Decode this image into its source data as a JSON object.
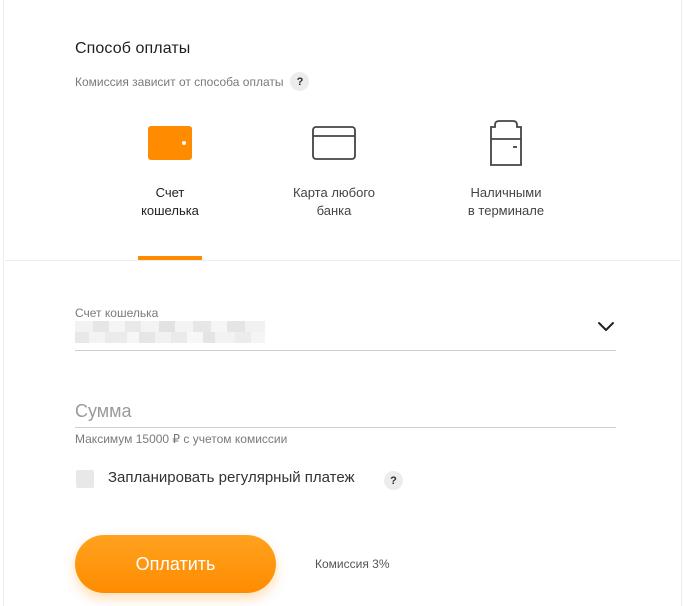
{
  "payment_method": {
    "title": "Способ оплаты",
    "subtitle": "Комиссия зависит от способа оплаты",
    "help": "?",
    "methods": [
      {
        "line1": "Счет",
        "line2": "кошелька",
        "icon": "wallet-icon",
        "active": true
      },
      {
        "line1": "Карта любого",
        "line2": "банка",
        "icon": "bank-card-icon",
        "active": false
      },
      {
        "line1": "Наличными",
        "line2": "в терминале",
        "icon": "terminal-icon",
        "active": false
      }
    ],
    "accent_color": "#ff8c00"
  },
  "account_select": {
    "label": "Счет кошелька",
    "value_masked": true
  },
  "amount": {
    "placeholder": "Сумма",
    "hint": "Максимум 15000 ₽ с учетом комиссии"
  },
  "recurring": {
    "label": "Запланировать регулярный платеж",
    "checked": false,
    "help": "?"
  },
  "pay_button": {
    "label": "Оплатить"
  },
  "fee_text": "Комиссия 3%"
}
